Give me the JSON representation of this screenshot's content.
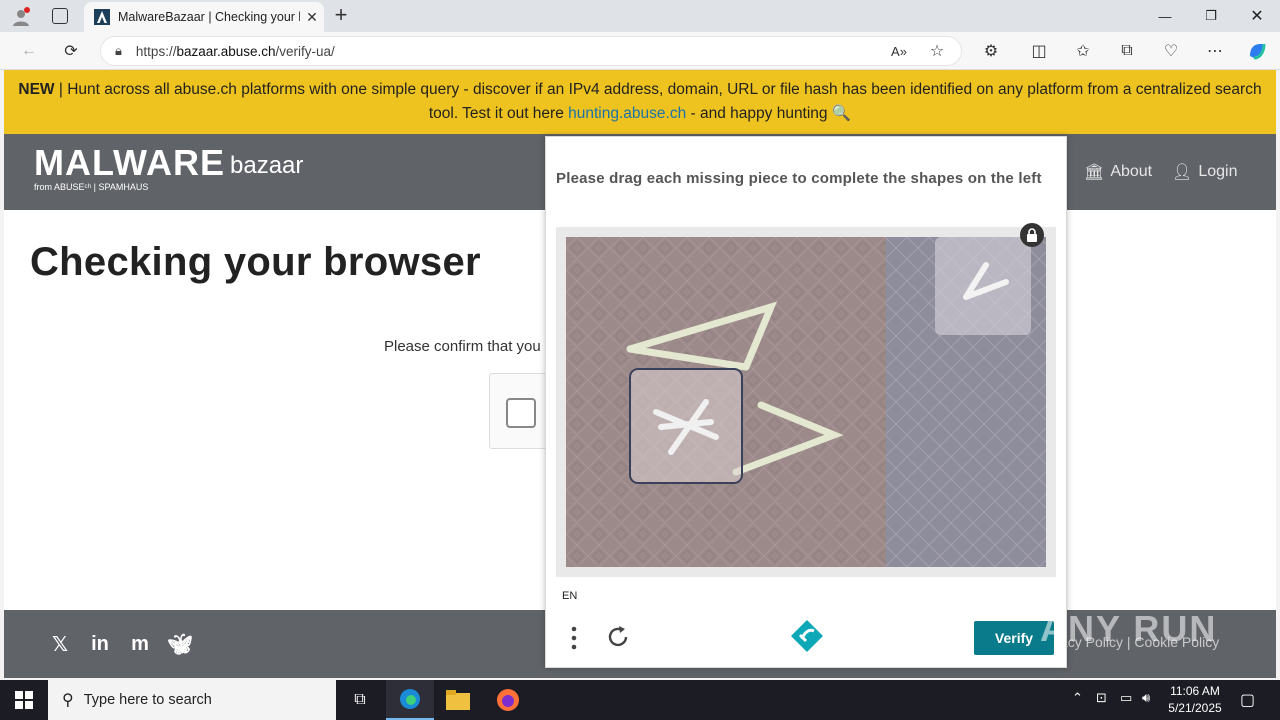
{
  "browser": {
    "tab_title": "MalwareBazaar | Checking your b",
    "url_prefix": "https://",
    "url_host": "bazaar.abuse.ch",
    "url_path": "/verify-ua/"
  },
  "banner": {
    "new_label": "NEW",
    "text_1": " | Hunt across all abuse.ch platforms with one simple query - discover if an IPv4 address, domain, URL or file hash has been identified on any platform from a centralized search tool. Test it out here ",
    "link": "hunting.abuse.ch",
    "text_2": " - and happy hunting 🔍"
  },
  "header": {
    "logo_main": "MALWARE",
    "logo_sub": "bazaar",
    "logo_from": "from ABUSEᶜʰ | SPAMHAUS",
    "nav_about": "About",
    "nav_login": "Login"
  },
  "main": {
    "heading": "Checking your browser",
    "confirm_text": "Please confirm that you"
  },
  "footer": {
    "links": "acy Policy  |  Cookie Policy"
  },
  "captcha": {
    "prompt": "Please drag each missing piece to complete the shapes on the left",
    "lang": "EN",
    "verify_label": "Verify"
  },
  "watermark": "ANY RUN",
  "taskbar": {
    "search_placeholder": "Type here to search",
    "time": "11:06 AM",
    "date": "5/21/2025"
  },
  "colors": {
    "banner": "#efc31f",
    "header": "#606368",
    "verify": "#0a7b8a",
    "link": "#1a73a8"
  }
}
